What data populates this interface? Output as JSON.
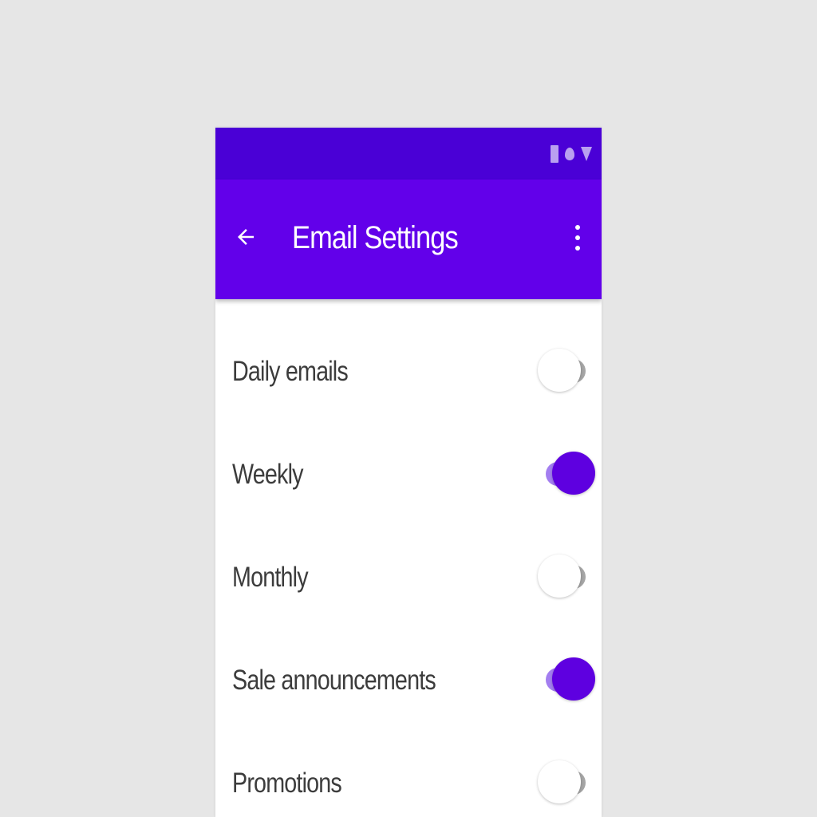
{
  "colors": {
    "status_bar": "#4a00d6",
    "app_bar": "#6200ea",
    "switch_on_thumb": "#5e00e0",
    "switch_on_track": "#a37ef0",
    "switch_off_track": "#a5a5a5",
    "background": "#e6e6e6"
  },
  "status_bar": {
    "icons": [
      "battery-icon",
      "wifi-icon",
      "signal-icon"
    ]
  },
  "app_bar": {
    "back_icon": "arrow-back-icon",
    "title": "Email Settings",
    "menu_icon": "more-vert-icon"
  },
  "settings": [
    {
      "label": "Daily emails",
      "enabled": false
    },
    {
      "label": "Weekly",
      "enabled": true
    },
    {
      "label": "Monthly",
      "enabled": false
    },
    {
      "label": "Sale announcements",
      "enabled": true
    },
    {
      "label": "Promotions",
      "enabled": false
    }
  ]
}
